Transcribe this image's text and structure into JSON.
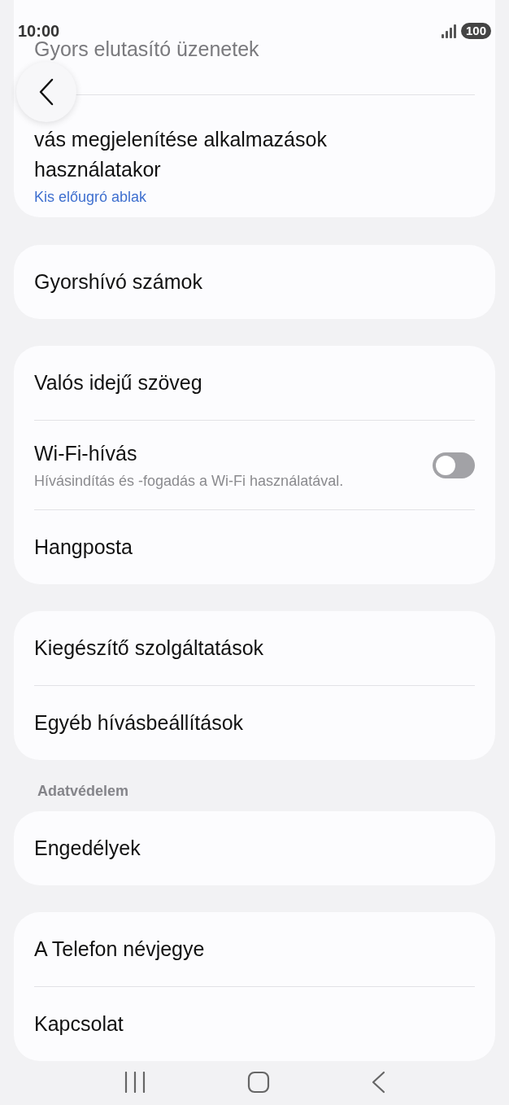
{
  "status_bar": {
    "time": "10:00",
    "battery": "100"
  },
  "groups": [
    {
      "items": [
        {
          "title": "Gyors elutasító üzenetek",
          "faded": true
        },
        {
          "kind": "link_summary",
          "title": "vás megjelenítése alkalmazások használatakor",
          "faded": false,
          "summary": "Kis előugró ablak"
        }
      ]
    },
    {
      "items": [
        {
          "title": "Gyorshívó számok",
          "faded": false
        }
      ]
    },
    {
      "items": [
        {
          "title": "Valós idejű szöveg",
          "faded": false
        },
        {
          "kind": "description",
          "title": "Wi-Fi-hívás",
          "faded": false,
          "summary": "Hívásindítás és -fogadás a Wi-Fi használatával.",
          "toggle": {
            "on": false
          }
        },
        {
          "title": "Hangposta",
          "faded": false
        }
      ]
    },
    {
      "items": [
        {
          "title": "Kiegészítő szolgáltatások",
          "faded": false
        },
        {
          "title": "Egyéb hívásbeállítások",
          "faded": false
        }
      ]
    },
    {
      "header": "Adatvédelem",
      "items": [
        {
          "title": "Engedélyek",
          "faded": false
        }
      ]
    },
    {
      "items": [
        {
          "title": "A Telefon névjegye",
          "faded": false
        },
        {
          "title": "Kapcsolat",
          "faded": false
        }
      ]
    }
  ]
}
